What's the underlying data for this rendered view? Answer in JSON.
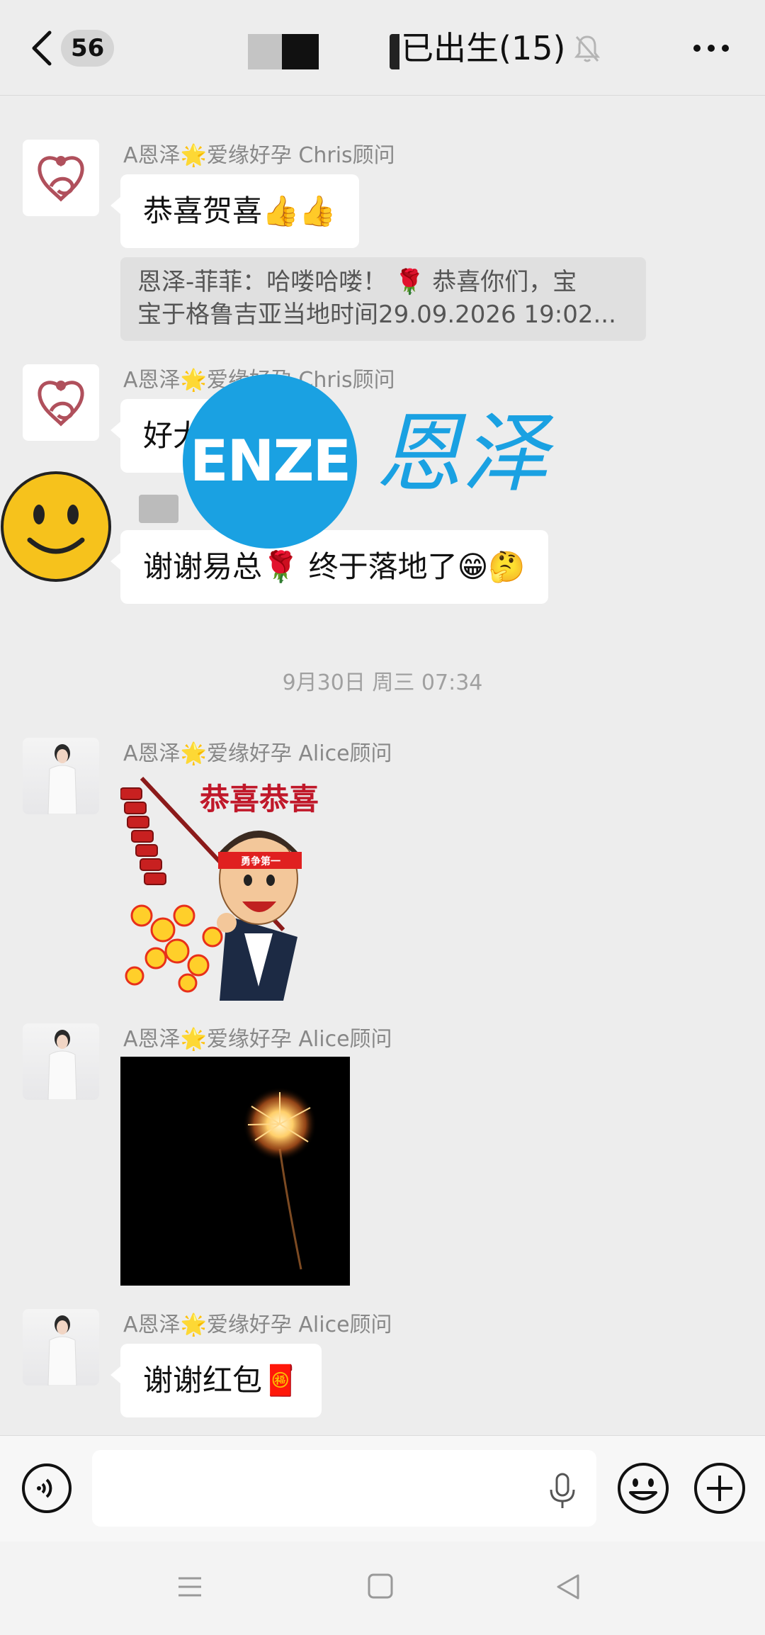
{
  "header": {
    "unread_count": "56",
    "title": "已出生(15)"
  },
  "messages": [
    {
      "sender": "A恩泽🌟爱缘好孕 Chris顾问",
      "text": "恭喜贺喜👍👍"
    },
    {
      "quote_line1": "恩泽-菲菲：哈喽哈喽！ 🌹 恭喜你们，宝",
      "quote_line2": "宝于格鲁吉亚当地时间29.09.2026 19:02..."
    },
    {
      "sender": "A恩泽🌟爱缘好孕 Chris顾问",
      "text": "好大"
    },
    {
      "text": "谢谢易总🌹 终于落地了😁🤔"
    },
    {
      "sender": "A恩泽🌟爱缘好孕 Alice顾问",
      "sticker_text": "恭喜恭喜",
      "headband_text": "勇争第一"
    },
    {
      "sender": "A恩泽🌟爱缘好孕 Alice顾问"
    },
    {
      "sender": "A恩泽🌟爱缘好孕 Alice顾问",
      "text": "谢谢红包🧧"
    }
  ],
  "timestamp": "9月30日 周三 07:34",
  "watermark": {
    "latin": "ENZE",
    "chinese": "恩泽"
  },
  "input": {
    "value": "",
    "placeholder": ""
  },
  "colors": {
    "brand_blue": "#1aa1e2",
    "background": "#ededed",
    "bubble": "#ffffff"
  },
  "icons": [
    "back-icon",
    "mute-bell-icon",
    "more-icon",
    "voice-icon",
    "mic-icon",
    "emoji-icon",
    "plus-icon",
    "nav-menu-icon",
    "nav-home-icon",
    "nav-back-icon"
  ]
}
